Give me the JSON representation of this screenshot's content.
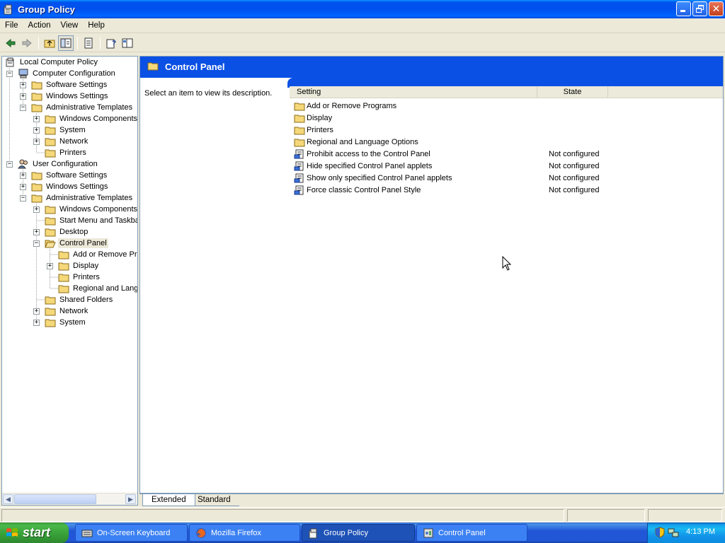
{
  "window": {
    "title": "Group Policy"
  },
  "menu": [
    "File",
    "Action",
    "View",
    "Help"
  ],
  "toolbar": {
    "icons": [
      "back-icon",
      "forward-icon",
      "up-folder-icon",
      "show-hide-tree-icon",
      "export-list-icon",
      "help-icon",
      "properties-icon"
    ]
  },
  "tree": {
    "root": "Local Computer Policy",
    "computer_config": "Computer Configuration",
    "cc_software": "Software Settings",
    "cc_windows": "Windows Settings",
    "cc_admin": "Administrative Templates",
    "cc_wincomp": "Windows Components",
    "cc_system": "System",
    "cc_network": "Network",
    "cc_printers": "Printers",
    "user_config": "User Configuration",
    "uc_software": "Software Settings",
    "uc_windows": "Windows Settings",
    "uc_admin": "Administrative Templates",
    "uc_wincomp": "Windows Components",
    "uc_startmenu": "Start Menu and Taskba",
    "uc_desktop": "Desktop",
    "uc_controlpanel": "Control Panel",
    "cp_addremove": "Add or Remove Pro",
    "cp_display": "Display",
    "cp_printers": "Printers",
    "cp_regional": "Regional and Langu",
    "uc_shared": "Shared Folders",
    "uc_network": "Network",
    "uc_system": "System"
  },
  "details": {
    "title": "Control Panel",
    "description": "Select an item to view its description.",
    "columns": {
      "setting": "Setting",
      "state": "State"
    },
    "rows": [
      {
        "name": "Add or Remove Programs",
        "state": "",
        "type": "folder"
      },
      {
        "name": "Display",
        "state": "",
        "type": "folder"
      },
      {
        "name": "Printers",
        "state": "",
        "type": "folder"
      },
      {
        "name": "Regional and Language Options",
        "state": "",
        "type": "folder"
      },
      {
        "name": "Prohibit access to the Control Panel",
        "state": "Not configured",
        "type": "policy"
      },
      {
        "name": "Hide specified Control Panel applets",
        "state": "Not configured",
        "type": "policy"
      },
      {
        "name": "Show only specified Control Panel applets",
        "state": "Not configured",
        "type": "policy"
      },
      {
        "name": "Force classic Control Panel Style",
        "state": "Not configured",
        "type": "policy"
      }
    ]
  },
  "tabs": {
    "extended": "Extended",
    "standard": "Standard"
  },
  "taskbar": {
    "start": "start",
    "items": [
      "On-Screen Keyboard",
      "Mozilla Firefox",
      "Group Policy",
      "Control Panel"
    ],
    "active_item": "Group Policy",
    "clock": "4:13 PM"
  },
  "colors": {
    "titlebar_blue": "#0053ee",
    "header_band_blue": "#0a50e4",
    "folder_yellow": "#f5d87a",
    "start_green": "#3c9a3c"
  }
}
